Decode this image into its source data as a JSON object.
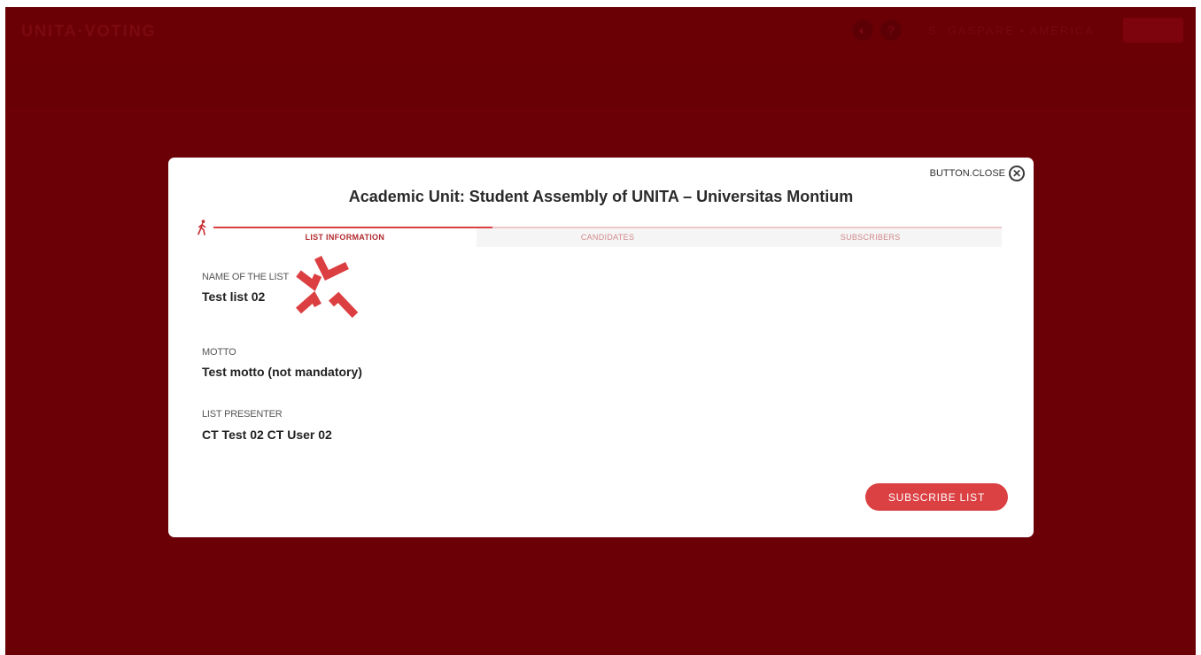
{
  "background": {
    "brand": "UNITA·VOTING",
    "user": "S. GASPARE • AMERICA"
  },
  "modal": {
    "close_label": "BUTTON.CLOSE",
    "title": "Academic Unit: Student Assembly of UNITA – Universitas Montium",
    "progress": 0.354,
    "steps": [
      {
        "label": "LIST INFORMATION",
        "active": true
      },
      {
        "label": "CANDIDATES",
        "active": false
      },
      {
        "label": "SUBSCRIBERS",
        "active": false
      }
    ],
    "fields": {
      "name": {
        "label": "NAME OF THE LIST",
        "value": "Test list 02"
      },
      "motto": {
        "label": "MOTTO",
        "value": "Test motto (not mandatory)"
      },
      "presenter": {
        "label": "LIST PRESENTER",
        "value": "CT Test 02 CT User 02"
      }
    },
    "subscribe_label": "SUBSCRIBE LIST"
  },
  "colors": {
    "backdrop": "#6b0007",
    "accent": "#dc3f41",
    "inactive_step": "#d2888a"
  },
  "icons": {
    "close": "close-circle-icon",
    "walker": "walking-person-icon",
    "deco": "angry-vein-icon"
  }
}
